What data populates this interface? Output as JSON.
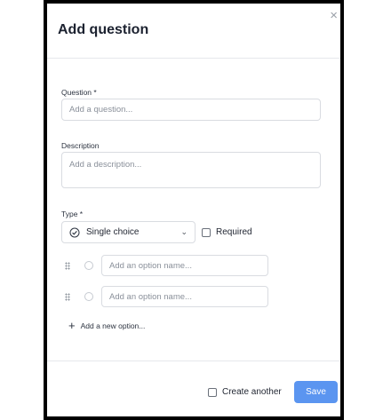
{
  "dialog": {
    "title": "Add question",
    "close_icon": "close-icon",
    "question": {
      "label": "Question *",
      "placeholder": "Add a question..."
    },
    "description": {
      "label": "Description",
      "placeholder": "Add a description..."
    },
    "type": {
      "label": "Type *",
      "selected": "Single choice",
      "icon": "check-circle-icon",
      "required_label": "Required",
      "required_checked": false
    },
    "options": [
      {
        "placeholder": "Add an option name..."
      },
      {
        "placeholder": "Add an option name..."
      }
    ],
    "add_option_label": "Add a new option...",
    "footer": {
      "create_another_label": "Create another",
      "create_another_checked": false,
      "save_label": "Save"
    },
    "colors": {
      "primary": "#5b95f0",
      "border": "#d9dce1",
      "frame": "#000000"
    }
  }
}
